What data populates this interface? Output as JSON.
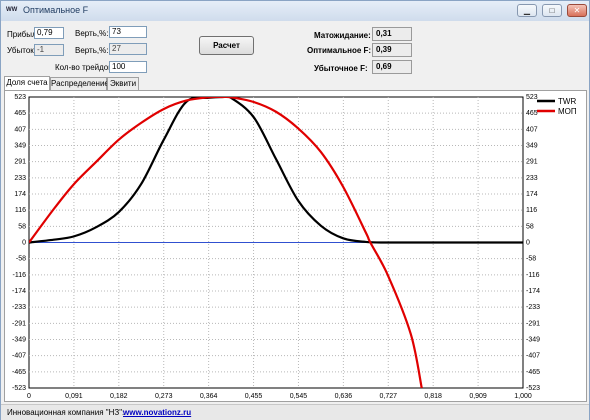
{
  "window": {
    "title": "Оптимальное F",
    "icon_text": "WW"
  },
  "params": {
    "profit_label": "Прибыль:",
    "profit_value": "0,79",
    "prob1_label": "Верть,%:",
    "prob1_value": "73",
    "loss_label": "Убыток:",
    "loss_value": "-1",
    "prob2_label": "Верть,%:",
    "prob2_value": "27",
    "trades_label": "Кол-во трейдов:",
    "trades_value": "100",
    "calc_button": "Расчет"
  },
  "results": {
    "expectation_label": "Матожидание:",
    "expectation_value": "0,31",
    "optimal_label": "Оптимальное F:",
    "optimal_value": "0,39",
    "loss_f_label": "Убыточное F:",
    "loss_f_value": "0,69"
  },
  "tabs": [
    "Доля счета",
    "Распределение",
    "Эквити"
  ],
  "status": {
    "company": "Инновационная компания \"НЗ\":",
    "link": "www.novationz.ru"
  },
  "chart_data": {
    "type": "line",
    "x_ticks": [
      "0",
      "0,091",
      "0,182",
      "0,273",
      "0,364",
      "0,455",
      "0,545",
      "0,636",
      "0,727",
      "0,818",
      "0,909",
      "1,000"
    ],
    "y_ticks": [
      "523",
      "465",
      "407",
      "349",
      "291",
      "233",
      "174",
      "116",
      "58",
      "0",
      "-58",
      "-116",
      "-174",
      "-233",
      "-291",
      "-349",
      "-407",
      "-465",
      "-523"
    ],
    "xlim": [
      0,
      1
    ],
    "ylim": [
      -523,
      523
    ],
    "grid": true,
    "legend_position": "top-right",
    "series": [
      {
        "name": "TWR",
        "color": "#000000",
        "x": [
          0,
          0.05,
          0.091,
          0.136,
          0.182,
          0.227,
          0.273,
          0.318,
          0.364,
          0.391,
          0.409,
          0.455,
          0.5,
          0.545,
          0.591,
          0.636,
          0.682,
          0.727,
          0.818,
          0.909,
          1.0
        ],
        "y": [
          0,
          10,
          22,
          55,
          110,
          210,
          370,
          505,
          520,
          523,
          520,
          450,
          300,
          150,
          60,
          15,
          2,
          0,
          0,
          0,
          0
        ]
      },
      {
        "name": "МОП",
        "color": "#e00000",
        "x": [
          0,
          0.05,
          0.091,
          0.136,
          0.182,
          0.227,
          0.273,
          0.318,
          0.364,
          0.391,
          0.409,
          0.455,
          0.5,
          0.545,
          0.591,
          0.636,
          0.682,
          0.691,
          0.727,
          0.773,
          0.795
        ],
        "y": [
          0,
          120,
          210,
          290,
          370,
          430,
          480,
          510,
          522,
          523,
          522,
          505,
          470,
          410,
          325,
          200,
          35,
          0,
          -120,
          -330,
          -523
        ]
      }
    ],
    "baseline_color": "#3050d0"
  }
}
